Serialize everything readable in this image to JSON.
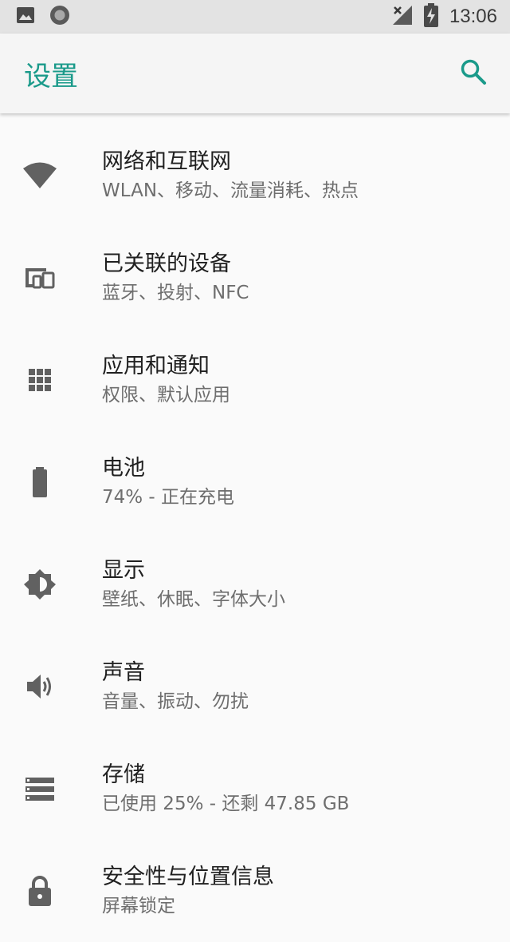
{
  "status_bar": {
    "time": "13:06",
    "icons": [
      "image-icon",
      "record-icon",
      "signal-off-icon",
      "battery-charging-icon"
    ]
  },
  "app_bar": {
    "title": "设置",
    "search_icon": "search-icon",
    "accent": "#1a9a8a"
  },
  "items": [
    {
      "icon": "wifi-icon",
      "title": "网络和互联网",
      "subtitle": "WLAN、移动、流量消耗、热点"
    },
    {
      "icon": "devices-icon",
      "title": "已关联的设备",
      "subtitle": "蓝牙、投射、NFC"
    },
    {
      "icon": "apps-icon",
      "title": "应用和通知",
      "subtitle": "权限、默认应用"
    },
    {
      "icon": "battery-icon",
      "title": "电池",
      "subtitle": "74% - 正在充电"
    },
    {
      "icon": "brightness-icon",
      "title": "显示",
      "subtitle": "壁纸、休眠、字体大小"
    },
    {
      "icon": "volume-icon",
      "title": "声音",
      "subtitle": "音量、振动、勿扰"
    },
    {
      "icon": "storage-icon",
      "title": "存储",
      "subtitle": "已使用 25% - 还剩 47.85 GB"
    },
    {
      "icon": "lock-icon",
      "title": "安全性与位置信息",
      "subtitle": "屏幕锁定"
    }
  ]
}
